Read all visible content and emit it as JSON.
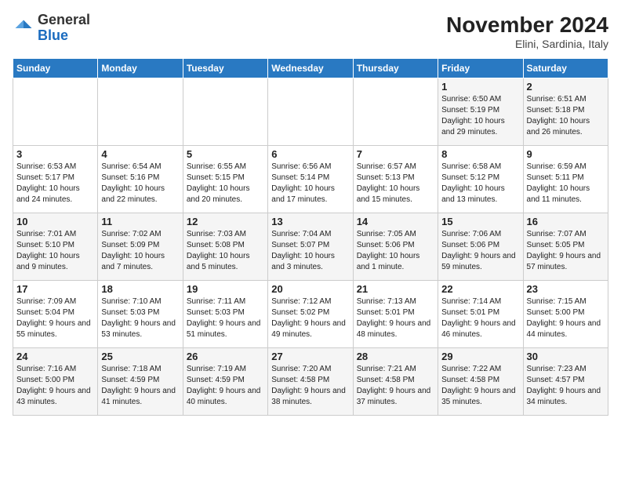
{
  "logo": {
    "general": "General",
    "blue": "Blue"
  },
  "header": {
    "month": "November 2024",
    "location": "Elini, Sardinia, Italy"
  },
  "weekdays": [
    "Sunday",
    "Monday",
    "Tuesday",
    "Wednesday",
    "Thursday",
    "Friday",
    "Saturday"
  ],
  "weeks": [
    [
      {
        "day": "",
        "text": ""
      },
      {
        "day": "",
        "text": ""
      },
      {
        "day": "",
        "text": ""
      },
      {
        "day": "",
        "text": ""
      },
      {
        "day": "",
        "text": ""
      },
      {
        "day": "1",
        "text": "Sunrise: 6:50 AM\nSunset: 5:19 PM\nDaylight: 10 hours and 29 minutes."
      },
      {
        "day": "2",
        "text": "Sunrise: 6:51 AM\nSunset: 5:18 PM\nDaylight: 10 hours and 26 minutes."
      }
    ],
    [
      {
        "day": "3",
        "text": "Sunrise: 6:53 AM\nSunset: 5:17 PM\nDaylight: 10 hours and 24 minutes."
      },
      {
        "day": "4",
        "text": "Sunrise: 6:54 AM\nSunset: 5:16 PM\nDaylight: 10 hours and 22 minutes."
      },
      {
        "day": "5",
        "text": "Sunrise: 6:55 AM\nSunset: 5:15 PM\nDaylight: 10 hours and 20 minutes."
      },
      {
        "day": "6",
        "text": "Sunrise: 6:56 AM\nSunset: 5:14 PM\nDaylight: 10 hours and 17 minutes."
      },
      {
        "day": "7",
        "text": "Sunrise: 6:57 AM\nSunset: 5:13 PM\nDaylight: 10 hours and 15 minutes."
      },
      {
        "day": "8",
        "text": "Sunrise: 6:58 AM\nSunset: 5:12 PM\nDaylight: 10 hours and 13 minutes."
      },
      {
        "day": "9",
        "text": "Sunrise: 6:59 AM\nSunset: 5:11 PM\nDaylight: 10 hours and 11 minutes."
      }
    ],
    [
      {
        "day": "10",
        "text": "Sunrise: 7:01 AM\nSunset: 5:10 PM\nDaylight: 10 hours and 9 minutes."
      },
      {
        "day": "11",
        "text": "Sunrise: 7:02 AM\nSunset: 5:09 PM\nDaylight: 10 hours and 7 minutes."
      },
      {
        "day": "12",
        "text": "Sunrise: 7:03 AM\nSunset: 5:08 PM\nDaylight: 10 hours and 5 minutes."
      },
      {
        "day": "13",
        "text": "Sunrise: 7:04 AM\nSunset: 5:07 PM\nDaylight: 10 hours and 3 minutes."
      },
      {
        "day": "14",
        "text": "Sunrise: 7:05 AM\nSunset: 5:06 PM\nDaylight: 10 hours and 1 minute."
      },
      {
        "day": "15",
        "text": "Sunrise: 7:06 AM\nSunset: 5:06 PM\nDaylight: 9 hours and 59 minutes."
      },
      {
        "day": "16",
        "text": "Sunrise: 7:07 AM\nSunset: 5:05 PM\nDaylight: 9 hours and 57 minutes."
      }
    ],
    [
      {
        "day": "17",
        "text": "Sunrise: 7:09 AM\nSunset: 5:04 PM\nDaylight: 9 hours and 55 minutes."
      },
      {
        "day": "18",
        "text": "Sunrise: 7:10 AM\nSunset: 5:03 PM\nDaylight: 9 hours and 53 minutes."
      },
      {
        "day": "19",
        "text": "Sunrise: 7:11 AM\nSunset: 5:03 PM\nDaylight: 9 hours and 51 minutes."
      },
      {
        "day": "20",
        "text": "Sunrise: 7:12 AM\nSunset: 5:02 PM\nDaylight: 9 hours and 49 minutes."
      },
      {
        "day": "21",
        "text": "Sunrise: 7:13 AM\nSunset: 5:01 PM\nDaylight: 9 hours and 48 minutes."
      },
      {
        "day": "22",
        "text": "Sunrise: 7:14 AM\nSunset: 5:01 PM\nDaylight: 9 hours and 46 minutes."
      },
      {
        "day": "23",
        "text": "Sunrise: 7:15 AM\nSunset: 5:00 PM\nDaylight: 9 hours and 44 minutes."
      }
    ],
    [
      {
        "day": "24",
        "text": "Sunrise: 7:16 AM\nSunset: 5:00 PM\nDaylight: 9 hours and 43 minutes."
      },
      {
        "day": "25",
        "text": "Sunrise: 7:18 AM\nSunset: 4:59 PM\nDaylight: 9 hours and 41 minutes."
      },
      {
        "day": "26",
        "text": "Sunrise: 7:19 AM\nSunset: 4:59 PM\nDaylight: 9 hours and 40 minutes."
      },
      {
        "day": "27",
        "text": "Sunrise: 7:20 AM\nSunset: 4:58 PM\nDaylight: 9 hours and 38 minutes."
      },
      {
        "day": "28",
        "text": "Sunrise: 7:21 AM\nSunset: 4:58 PM\nDaylight: 9 hours and 37 minutes."
      },
      {
        "day": "29",
        "text": "Sunrise: 7:22 AM\nSunset: 4:58 PM\nDaylight: 9 hours and 35 minutes."
      },
      {
        "day": "30",
        "text": "Sunrise: 7:23 AM\nSunset: 4:57 PM\nDaylight: 9 hours and 34 minutes."
      }
    ]
  ]
}
